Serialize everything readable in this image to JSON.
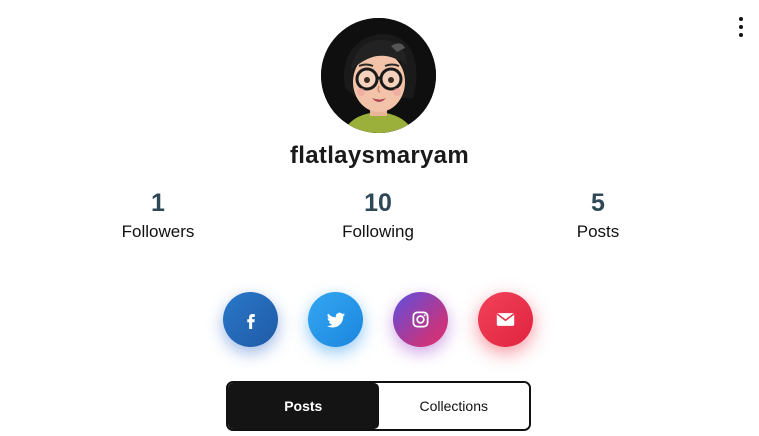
{
  "profile": {
    "username": "flatlaysmaryam",
    "avatar_icon": "avatar-illustration-icon"
  },
  "stats": {
    "followers": {
      "value": "1",
      "label": "Followers"
    },
    "following": {
      "value": "10",
      "label": "Following"
    },
    "posts": {
      "value": "5",
      "label": "Posts"
    }
  },
  "menu": {
    "icon": "more-vertical-icon"
  },
  "social": [
    {
      "name": "facebook",
      "icon": "facebook-icon",
      "color": "#2468b8"
    },
    {
      "name": "twitter",
      "icon": "twitter-icon",
      "color": "#2196e8"
    },
    {
      "name": "instagram",
      "icon": "instagram-icon",
      "color": "#9b3bbf"
    },
    {
      "name": "email",
      "icon": "email-icon",
      "color": "#ec3350"
    }
  ],
  "tabs": [
    {
      "label": "Posts",
      "active": true
    },
    {
      "label": "Collections",
      "active": false
    }
  ],
  "colors": {
    "stat_number": "#2f4858",
    "active_tab_bg": "#141414"
  }
}
